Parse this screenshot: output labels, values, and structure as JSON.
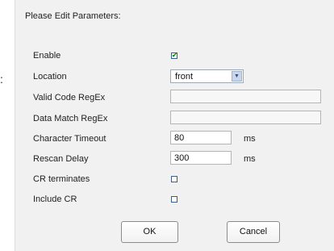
{
  "stray_text": ":",
  "dialog": {
    "title": "Please Edit Parameters:"
  },
  "params": {
    "enable": {
      "label": "Enable",
      "checked": true
    },
    "location": {
      "label": "Location",
      "value": "front"
    },
    "valid_code_regex": {
      "label": "Valid Code RegEx",
      "value": ""
    },
    "data_match_regex": {
      "label": "Data Match RegEx",
      "value": ""
    },
    "character_timeout": {
      "label": "Character Timeout",
      "value": "80",
      "unit": "ms"
    },
    "rescan_delay": {
      "label": "Rescan Delay",
      "value": "300",
      "unit": "ms"
    },
    "cr_terminates": {
      "label": "CR terminates",
      "checked": false
    },
    "include_cr": {
      "label": "Include CR",
      "checked": false
    }
  },
  "buttons": {
    "ok": "OK",
    "cancel": "Cancel"
  },
  "icons": {
    "check": "check-mark-icon",
    "dropdown": "chevron-down-icon"
  }
}
